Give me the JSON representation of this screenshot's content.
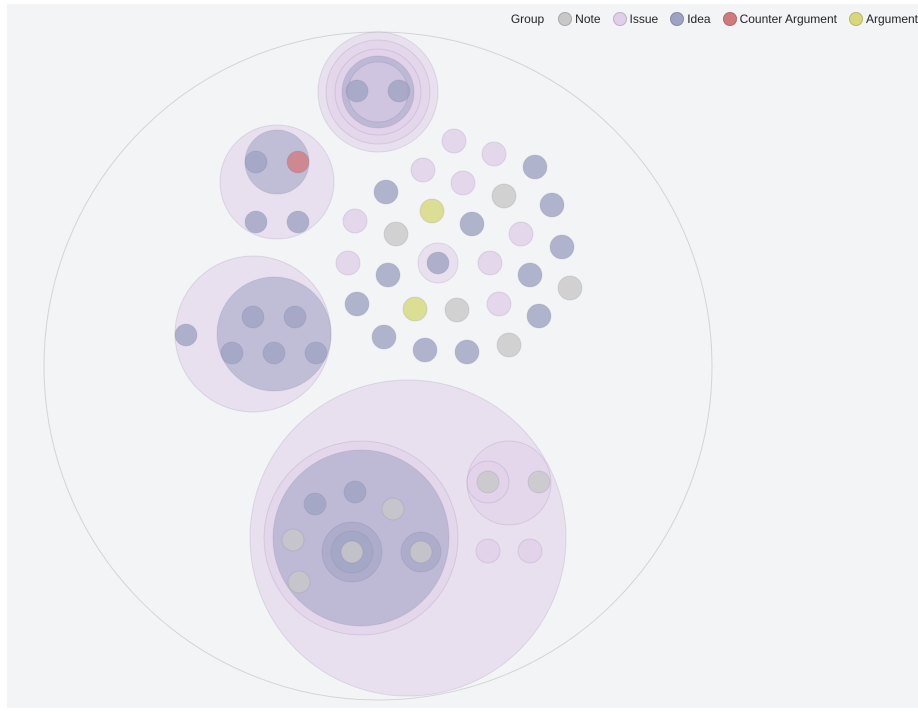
{
  "legend": {
    "title": "Group",
    "items": [
      {
        "label": "Note",
        "color": "#c8c8c8"
      },
      {
        "label": "Issue",
        "color": "#e0cfe9"
      },
      {
        "label": "Idea",
        "color": "#9ea3c2"
      },
      {
        "label": "Counter Argument",
        "color": "#cf7b7e"
      },
      {
        "label": "Argument",
        "color": "#d6d87a"
      }
    ]
  },
  "chart_data": {
    "type": "circle-packing",
    "title": "",
    "colors": {
      "Note": "#c8c8c8",
      "Issue": "#e0cfe9",
      "Idea": "#9ea3c2",
      "Counter Argument": "#cf7b7e",
      "Argument": "#d6d87a"
    },
    "tree": {
      "group": "root",
      "children": [
        {
          "group": "Issue",
          "children": [
            {
              "group": "Issue",
              "children": [
                {
                  "group": "Issue",
                  "children": [
                    {
                      "group": "Idea",
                      "children": [
                        {
                          "group": "Issue",
                          "children": [
                            {
                              "group": "Idea"
                            },
                            {
                              "group": "Idea"
                            }
                          ]
                        }
                      ]
                    }
                  ]
                }
              ]
            }
          ]
        },
        {
          "group": "Issue",
          "children": [
            {
              "group": "Idea",
              "children": [
                {
                  "group": "Idea"
                },
                {
                  "group": "Counter Argument"
                }
              ]
            },
            {
              "group": "Idea"
            },
            {
              "group": "Idea"
            }
          ]
        },
        {
          "group": "Issue",
          "children": [
            {
              "group": "Idea",
              "children": [
                {
                  "group": "Idea"
                },
                {
                  "group": "Idea"
                },
                {
                  "group": "Idea"
                },
                {
                  "group": "Idea"
                },
                {
                  "group": "Idea"
                }
              ]
            },
            {
              "group": "Idea"
            }
          ]
        },
        {
          "group": "Issue",
          "children": [
            {
              "group": "Idea"
            }
          ]
        },
        {
          "group": "Issue"
        },
        {
          "group": "Issue"
        },
        {
          "group": "Issue"
        },
        {
          "group": "Issue"
        },
        {
          "group": "Issue"
        },
        {
          "group": "Issue"
        },
        {
          "group": "Issue"
        },
        {
          "group": "Issue"
        },
        {
          "group": "Issue"
        },
        {
          "group": "Idea"
        },
        {
          "group": "Idea"
        },
        {
          "group": "Idea"
        },
        {
          "group": "Idea"
        },
        {
          "group": "Idea"
        },
        {
          "group": "Idea"
        },
        {
          "group": "Idea"
        },
        {
          "group": "Idea"
        },
        {
          "group": "Idea"
        },
        {
          "group": "Idea"
        },
        {
          "group": "Idea"
        },
        {
          "group": "Idea"
        },
        {
          "group": "Note"
        },
        {
          "group": "Note"
        },
        {
          "group": "Note"
        },
        {
          "group": "Note"
        },
        {
          "group": "Note"
        },
        {
          "group": "Argument"
        },
        {
          "group": "Argument"
        },
        {
          "group": "Issue",
          "children": [
            {
              "group": "Issue",
              "children": [
                {
                  "group": "Idea",
                  "children": [
                    {
                      "group": "Idea"
                    },
                    {
                      "group": "Idea"
                    },
                    {
                      "group": "Note"
                    },
                    {
                      "group": "Note"
                    },
                    {
                      "group": "Note"
                    },
                    {
                      "group": "Idea",
                      "children": [
                        {
                          "group": "Idea",
                          "children": [
                            {
                              "group": "Note"
                            }
                          ]
                        }
                      ]
                    },
                    {
                      "group": "Idea",
                      "children": [
                        {
                          "group": "Note"
                        }
                      ]
                    }
                  ]
                }
              ]
            },
            {
              "group": "Issue",
              "children": [
                {
                  "group": "Issue",
                  "children": [
                    {
                      "group": "Note"
                    }
                  ]
                },
                {
                  "group": "Note"
                }
              ]
            },
            {
              "group": "Issue"
            },
            {
              "group": "Issue"
            }
          ]
        }
      ]
    }
  }
}
